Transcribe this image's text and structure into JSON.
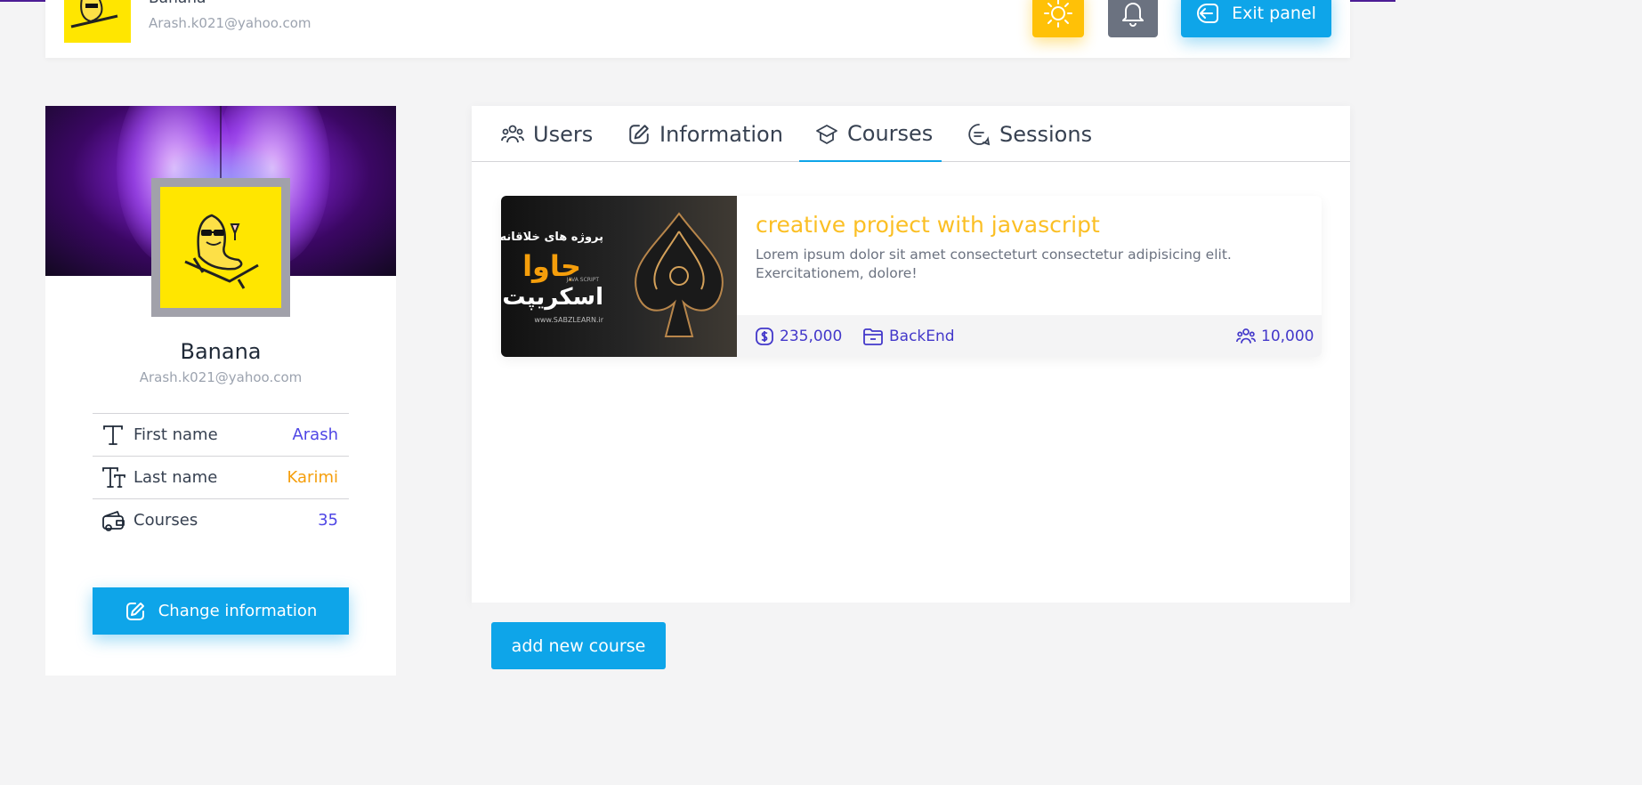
{
  "header": {
    "user_name": "Banana",
    "user_email": "Arash.k021@yahoo.com",
    "theme_icon": "sun-icon",
    "notification_icon": "bell-icon",
    "exit_label": "Exit panel",
    "colors": {
      "theme_button": "#ffc107",
      "bell_button": "#6b7280",
      "primary": "#0ea5e9"
    }
  },
  "profile": {
    "name": "Banana",
    "email": "Arash.k021@yahoo.com",
    "rows": [
      {
        "icon": "text-icon",
        "label": "First name",
        "value": "Arash",
        "value_color": "#4f46e5"
      },
      {
        "icon": "text-size-icon",
        "label": "Last name",
        "value": "Karimi",
        "value_color": "#f59e0b"
      },
      {
        "icon": "wallet-icon",
        "label": "Courses",
        "value": "35",
        "value_color": "#4f46e5"
      }
    ],
    "change_button": "Change information"
  },
  "tabs": [
    {
      "label": "Users",
      "icon": "users-icon",
      "active": false
    },
    {
      "label": "Information",
      "icon": "edit-icon",
      "active": false
    },
    {
      "label": "Courses",
      "icon": "graduation-cap-icon",
      "active": true
    },
    {
      "label": "Sessions",
      "icon": "message-icon",
      "active": false
    }
  ],
  "course": {
    "title": "creative project with javascript",
    "description": "Lorem ipsum dolor sit amet consecteturt consectetur adipisicing elit. Exercitationem, dolore!",
    "image_text_1": "پروژه های خلاقانه با",
    "image_text_2": "جاوا",
    "image_text_3": "اسکریپت",
    "image_text_4": "JAVA SCRIPT",
    "image_text_5": "www.SABZLEARN.ir",
    "price": "235,000",
    "category": "BackEnd",
    "students": "10,000"
  },
  "add_course_button": "add new course"
}
